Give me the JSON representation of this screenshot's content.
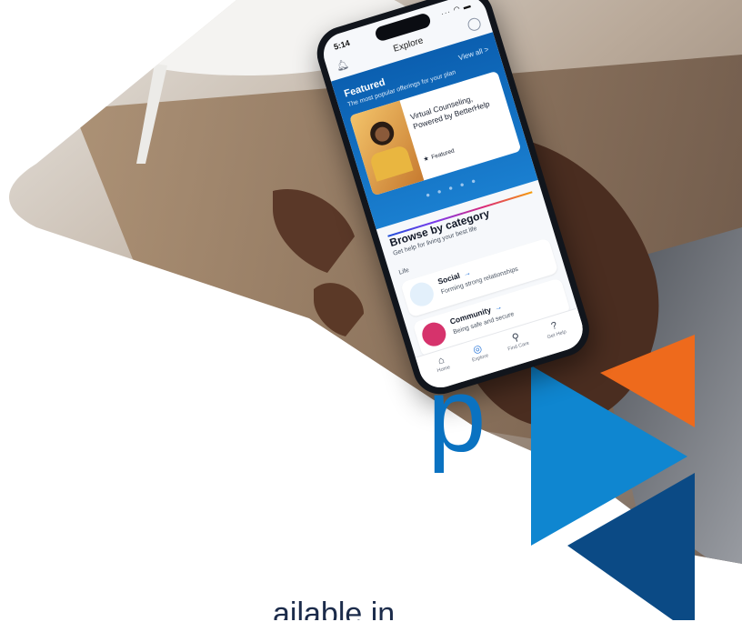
{
  "colors": {
    "brand_blue": "#0a72c1",
    "light_blue": "#0f86d0",
    "navy": "#0b4a85",
    "orange": "#ee6a1c"
  },
  "hero": {
    "letter": "p"
  },
  "bottom_text": "ailable in",
  "phone": {
    "status_time": "5:14",
    "status_icons": "···  ◠  ▬",
    "screen_title": "Explore",
    "featured": {
      "title": "Featured",
      "view_all": "View all >",
      "subtitle": "The most popular offerings for your plan",
      "card_title": "Virtual Counseling, Powered by BetterHelp",
      "card_badge": "Featured",
      "dots": "● ● ● ● ●"
    },
    "browse": {
      "title": "Browse by category",
      "subtitle": "Get help for living your best life",
      "section": "Life"
    },
    "categories": [
      {
        "label": "Social",
        "desc": "Forming strong relationships",
        "icon": "people-icon",
        "color": "#e3f0fb"
      },
      {
        "label": "Community",
        "desc": "Being safe and secure",
        "icon": "home-heart-icon",
        "color": "#d6336c"
      }
    ],
    "tabs": [
      {
        "label": "Home",
        "icon": "⌂"
      },
      {
        "label": "Explore",
        "icon": "◎"
      },
      {
        "label": "Find Care",
        "icon": "⚲"
      },
      {
        "label": "Get Help",
        "icon": "?"
      }
    ]
  }
}
